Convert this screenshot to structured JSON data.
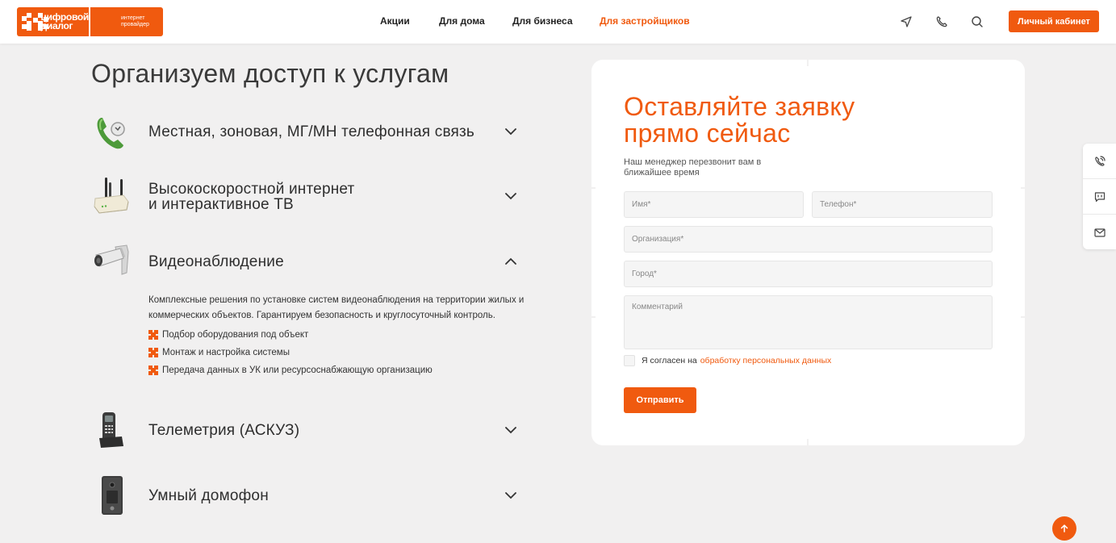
{
  "brand": {
    "name_line1": "цифровой",
    "name_line2": "диалог",
    "sub_line1": "интернет",
    "sub_line2": "провайдер",
    "accent": "#f05a0f"
  },
  "nav": {
    "items": [
      {
        "label": "Акции",
        "active": false
      },
      {
        "label": "Для дома",
        "active": false
      },
      {
        "label": "Для бизнеса",
        "active": false
      },
      {
        "label": "Для застройщиков",
        "active": true
      }
    ],
    "icons": [
      "location-arrow-icon",
      "phone-icon",
      "search-icon"
    ],
    "cabinet_label": "Личный кабинет"
  },
  "services": {
    "title": "Организуем доступ к услугам",
    "items": [
      {
        "name_line1": "Местная, зоновая, МГ/МН телефонная связь",
        "name_line2": "",
        "icon": "phone-handset-icon",
        "expanded": false
      },
      {
        "name_line1": "Высокоскоростной интернет",
        "name_line2": "и интерактивное ТВ",
        "icon": "router-icon",
        "expanded": false
      },
      {
        "name_line1": "Видеонаблюдение",
        "name_line2": "",
        "icon": "security-camera-icon",
        "expanded": true
      },
      {
        "name_line1": "Телеметрия (АСКУЗ)",
        "name_line2": "",
        "icon": "telemetry-device-icon",
        "expanded": false
      },
      {
        "name_line1": "Умный домофон",
        "name_line2": "",
        "icon": "intercom-icon",
        "expanded": false
      }
    ],
    "expanded_desc": "Комплексные решения по установке систем видеонаблюдения на территории жилых и коммерческих объектов. Гарантируем безопасность и круглосуточный контроль.",
    "expanded_bullets": [
      "Подбор оборудования под объект",
      "Монтаж и настройка системы",
      "Передача данных в УК или ресурсоснабжающую организацию"
    ]
  },
  "form": {
    "title_line1": "Оставляйте заявку",
    "title_line2": "прямо сейчас",
    "subtitle": "Наш менеджер перезвонит вам в ближайшее время",
    "name_placeholder": "Имя*",
    "phone_placeholder": "Телефон*",
    "org_placeholder": "Организация*",
    "city_placeholder": "Город*",
    "comment_placeholder": "Комментарий",
    "consent_text": "Я согласен на",
    "consent_link": "обработку персональных данных",
    "submit_label": "Отправить"
  },
  "side_widget": {
    "icons": [
      "callback-icon",
      "chat-icon",
      "mail-icon"
    ]
  }
}
